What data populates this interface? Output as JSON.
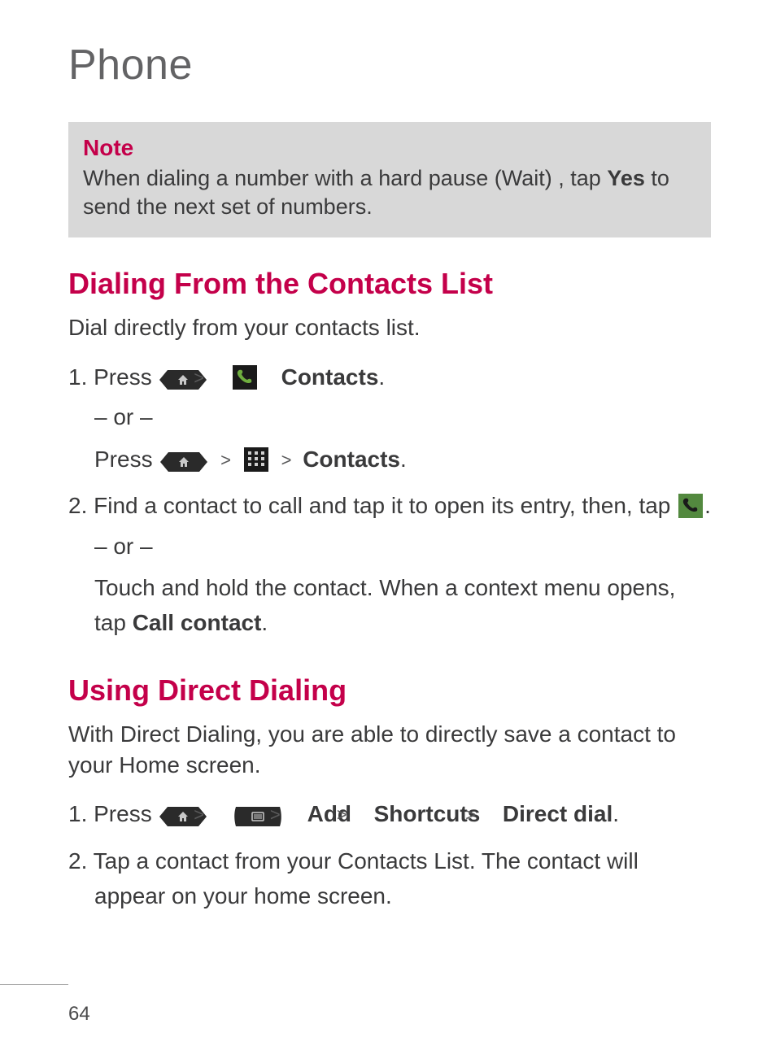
{
  "page_title": "Phone",
  "note": {
    "label": "Note",
    "text_before_bold": "When dialing a number with a hard pause (Wait) , tap ",
    "bold": "Yes",
    "text_after_bold": " to send the next set of numbers."
  },
  "section1": {
    "heading": "Dialing From the Contacts List",
    "intro": "Dial directly from your contacts list.",
    "step1": {
      "prefix": "1. Press ",
      "contacts_label": "Contacts",
      "or": "– or –",
      "press2": "Press "
    },
    "step2": {
      "text_before_icon": "2. Find a contact to call and tap it to open its entry, then, tap ",
      "period": ".",
      "or": "– or –",
      "followup_before_bold": "Touch and hold the contact. When a context menu opens, tap ",
      "followup_bold": "Call contact",
      "followup_after_bold": "."
    }
  },
  "section2": {
    "heading": "Using Direct Dialing",
    "intro": "With Direct Dialing, you are able to directly save a contact to your Home screen.",
    "step1": {
      "prefix": "1. Press ",
      "add": "Add",
      "shortcuts": "Shortcuts",
      "direct_dial": "Direct dial",
      "period": "."
    },
    "step2": "2. Tap a contact from your Contacts List. The contact will appear on your home screen."
  },
  "page_number": "64"
}
